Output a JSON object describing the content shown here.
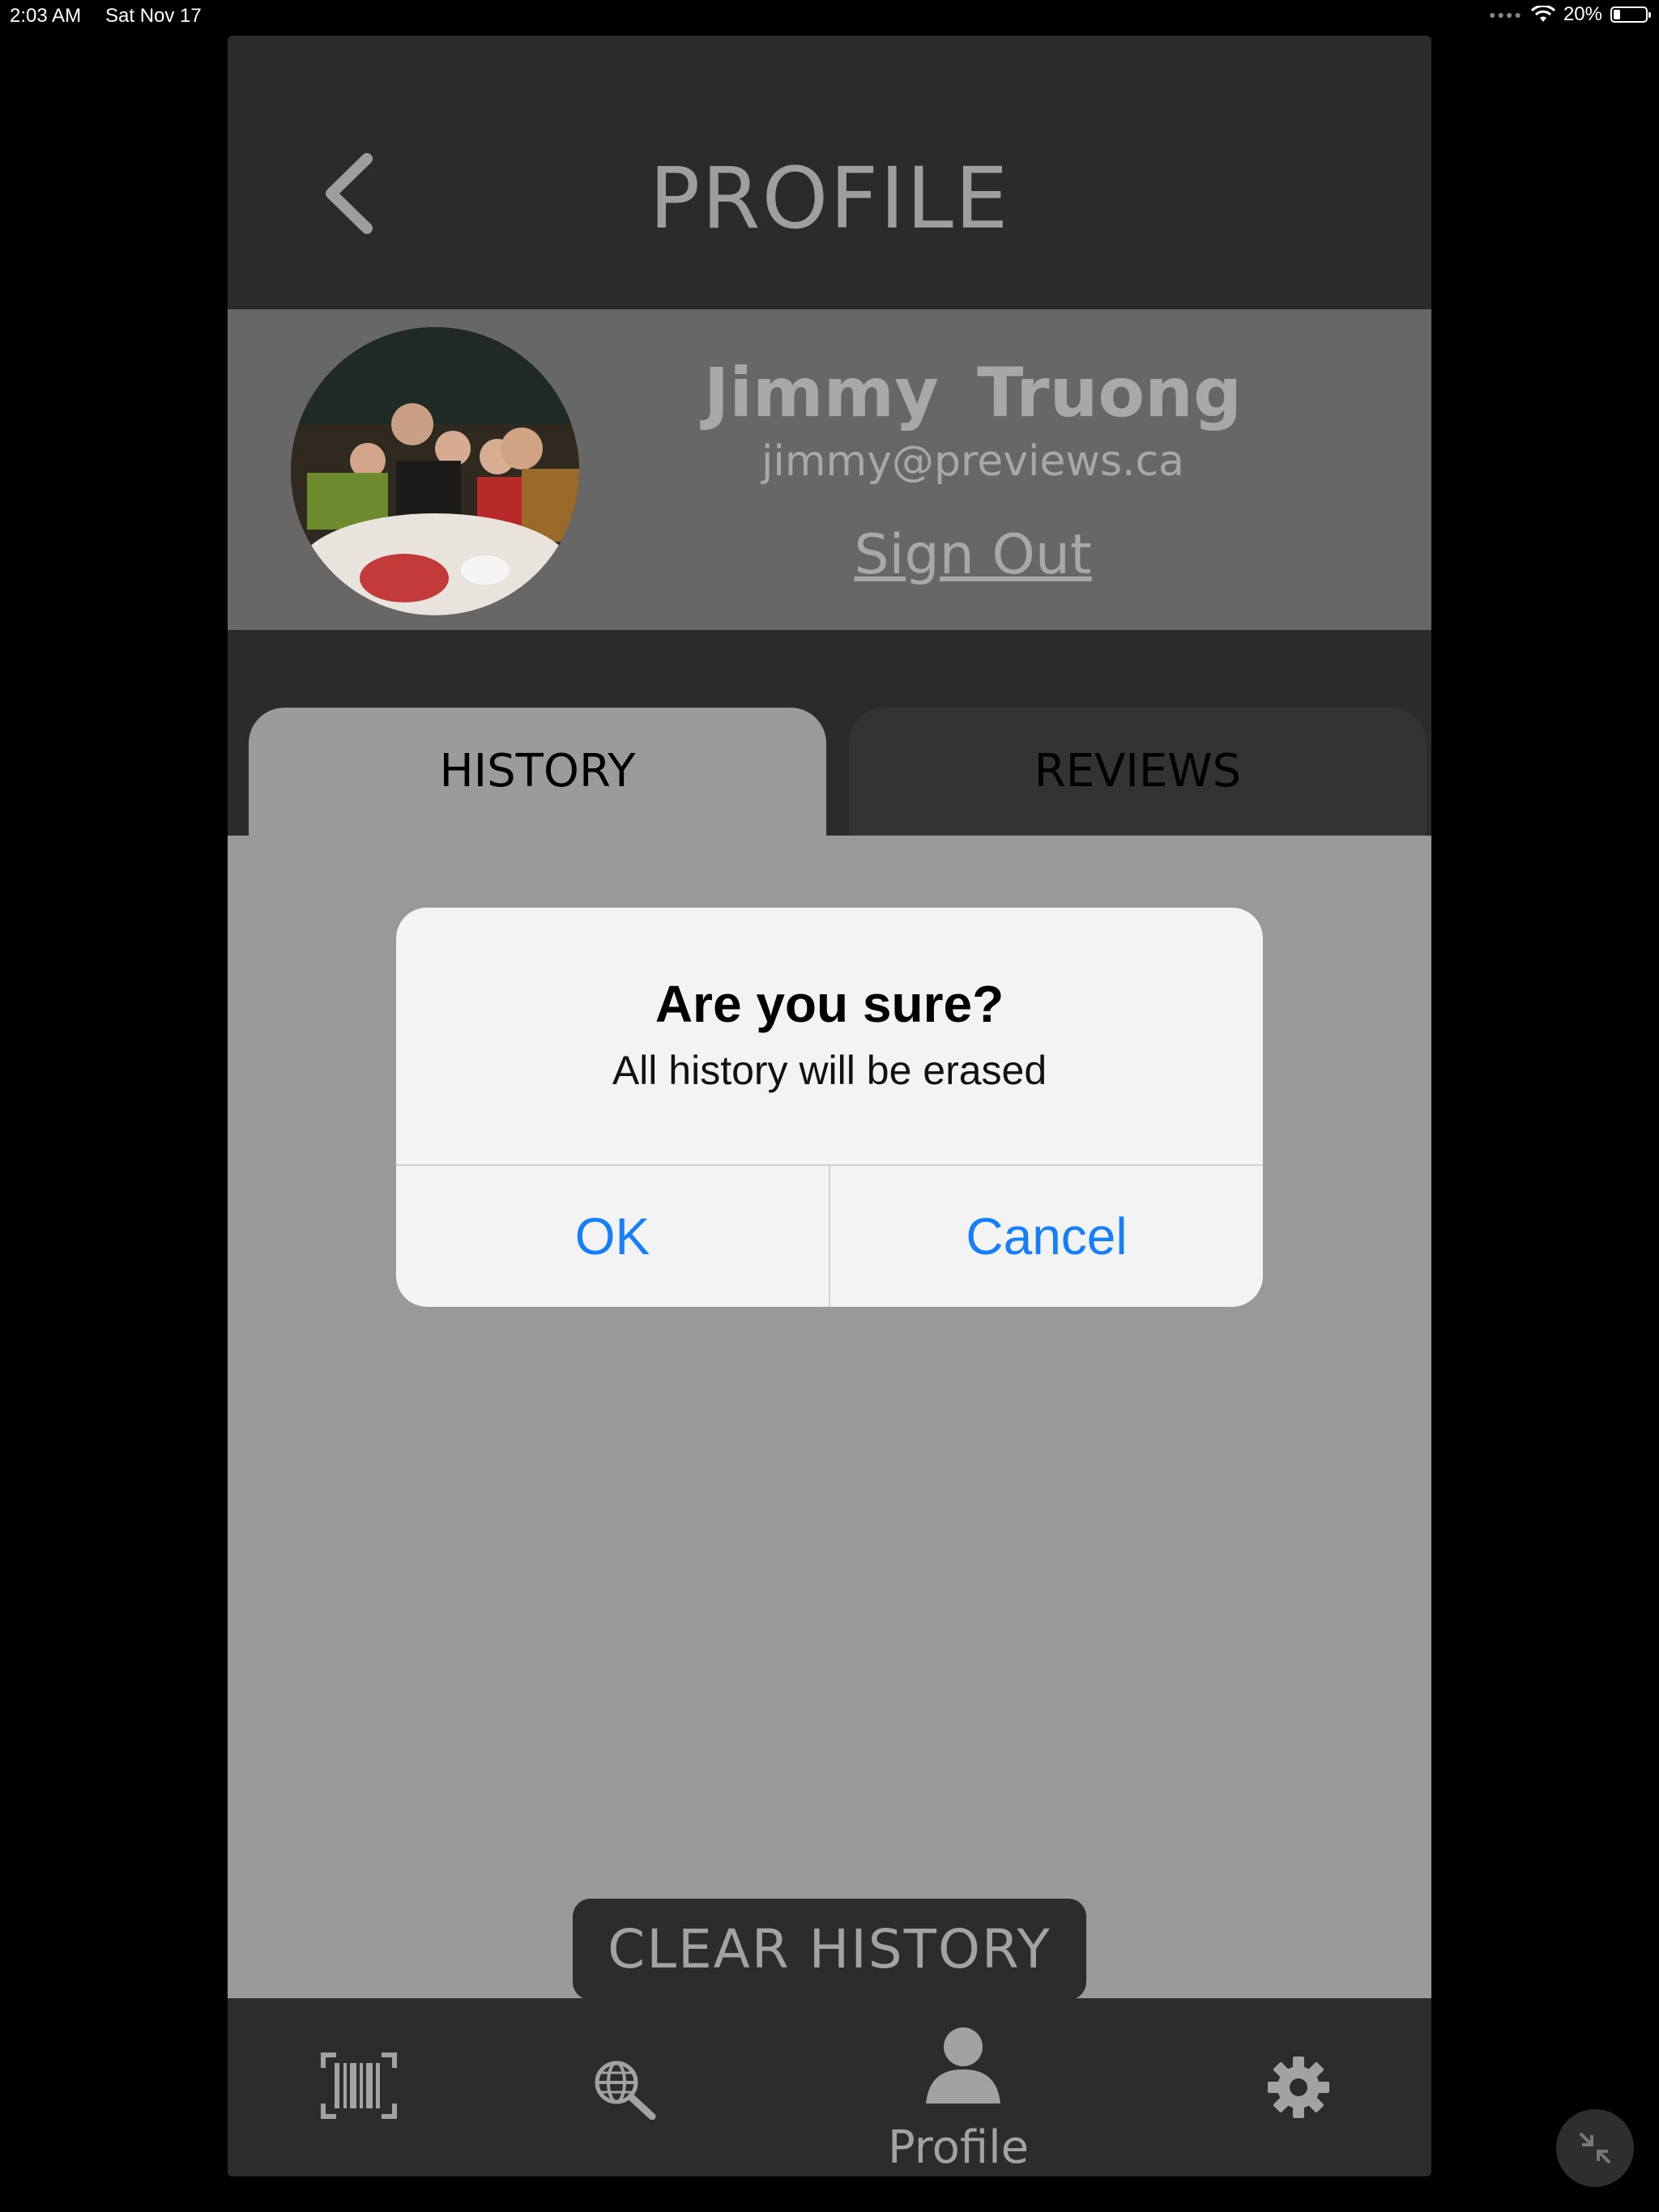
{
  "status_bar": {
    "time": "2:03 AM",
    "date": "Sat Nov 17",
    "battery": "20%",
    "battery_level": 0.2
  },
  "header": {
    "title": "PROFILE",
    "back_icon": "chevron-left-icon"
  },
  "profile": {
    "name": "Jimmy  Truong",
    "email": "jimmy@previews.ca",
    "sign_out": "Sign Out",
    "avatar": "profile-photo"
  },
  "tabs": [
    {
      "label": "HISTORY",
      "selected": true
    },
    {
      "label": "REVIEWS",
      "selected": false
    }
  ],
  "actions": {
    "clear_history": "CLEAR HISTORY"
  },
  "tab_bar": {
    "items": [
      "barcode-icon",
      "globe-search-icon",
      "person-icon",
      "gear-icon"
    ],
    "active_label": "Profile"
  },
  "dialog": {
    "title": "Are you sure?",
    "message": "All history will be erased",
    "ok": "OK",
    "cancel": "Cancel"
  },
  "colors": {
    "accent": "#157efb",
    "header_bg": "#2b2b2b",
    "content_bg": "#999999"
  }
}
